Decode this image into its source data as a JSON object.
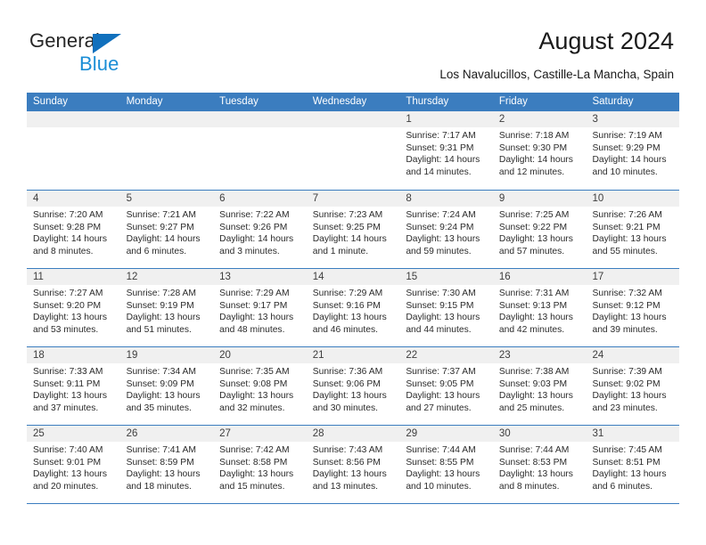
{
  "brand": {
    "name_part1": "General",
    "name_part2": "Blue",
    "accent_dark": "#1170bd",
    "accent_light": "#1b8ed6"
  },
  "header": {
    "title": "August 2024",
    "subtitle": "Los Navalucillos, Castille-La Mancha, Spain"
  },
  "theme": {
    "header_row_bg": "#3b7dbf",
    "daynum_bg": "#f0f0f0",
    "separator": "#3b7dbf"
  },
  "calendar": {
    "weekdays": [
      "Sunday",
      "Monday",
      "Tuesday",
      "Wednesday",
      "Thursday",
      "Friday",
      "Saturday"
    ],
    "weeks": [
      [
        {
          "day": "",
          "empty": true,
          "l1": "",
          "l2": "",
          "l3": "",
          "l4": ""
        },
        {
          "day": "",
          "empty": true,
          "l1": "",
          "l2": "",
          "l3": "",
          "l4": ""
        },
        {
          "day": "",
          "empty": true,
          "l1": "",
          "l2": "",
          "l3": "",
          "l4": ""
        },
        {
          "day": "",
          "empty": true,
          "l1": "",
          "l2": "",
          "l3": "",
          "l4": ""
        },
        {
          "day": "1",
          "l1": "Sunrise: 7:17 AM",
          "l2": "Sunset: 9:31 PM",
          "l3": "Daylight: 14 hours",
          "l4": "and 14 minutes."
        },
        {
          "day": "2",
          "l1": "Sunrise: 7:18 AM",
          "l2": "Sunset: 9:30 PM",
          "l3": "Daylight: 14 hours",
          "l4": "and 12 minutes."
        },
        {
          "day": "3",
          "l1": "Sunrise: 7:19 AM",
          "l2": "Sunset: 9:29 PM",
          "l3": "Daylight: 14 hours",
          "l4": "and 10 minutes."
        }
      ],
      [
        {
          "day": "4",
          "l1": "Sunrise: 7:20 AM",
          "l2": "Sunset: 9:28 PM",
          "l3": "Daylight: 14 hours",
          "l4": "and 8 minutes."
        },
        {
          "day": "5",
          "l1": "Sunrise: 7:21 AM",
          "l2": "Sunset: 9:27 PM",
          "l3": "Daylight: 14 hours",
          "l4": "and 6 minutes."
        },
        {
          "day": "6",
          "l1": "Sunrise: 7:22 AM",
          "l2": "Sunset: 9:26 PM",
          "l3": "Daylight: 14 hours",
          "l4": "and 3 minutes."
        },
        {
          "day": "7",
          "l1": "Sunrise: 7:23 AM",
          "l2": "Sunset: 9:25 PM",
          "l3": "Daylight: 14 hours",
          "l4": "and 1 minute."
        },
        {
          "day": "8",
          "l1": "Sunrise: 7:24 AM",
          "l2": "Sunset: 9:24 PM",
          "l3": "Daylight: 13 hours",
          "l4": "and 59 minutes."
        },
        {
          "day": "9",
          "l1": "Sunrise: 7:25 AM",
          "l2": "Sunset: 9:22 PM",
          "l3": "Daylight: 13 hours",
          "l4": "and 57 minutes."
        },
        {
          "day": "10",
          "l1": "Sunrise: 7:26 AM",
          "l2": "Sunset: 9:21 PM",
          "l3": "Daylight: 13 hours",
          "l4": "and 55 minutes."
        }
      ],
      [
        {
          "day": "11",
          "l1": "Sunrise: 7:27 AM",
          "l2": "Sunset: 9:20 PM",
          "l3": "Daylight: 13 hours",
          "l4": "and 53 minutes."
        },
        {
          "day": "12",
          "l1": "Sunrise: 7:28 AM",
          "l2": "Sunset: 9:19 PM",
          "l3": "Daylight: 13 hours",
          "l4": "and 51 minutes."
        },
        {
          "day": "13",
          "l1": "Sunrise: 7:29 AM",
          "l2": "Sunset: 9:17 PM",
          "l3": "Daylight: 13 hours",
          "l4": "and 48 minutes."
        },
        {
          "day": "14",
          "l1": "Sunrise: 7:29 AM",
          "l2": "Sunset: 9:16 PM",
          "l3": "Daylight: 13 hours",
          "l4": "and 46 minutes."
        },
        {
          "day": "15",
          "l1": "Sunrise: 7:30 AM",
          "l2": "Sunset: 9:15 PM",
          "l3": "Daylight: 13 hours",
          "l4": "and 44 minutes."
        },
        {
          "day": "16",
          "l1": "Sunrise: 7:31 AM",
          "l2": "Sunset: 9:13 PM",
          "l3": "Daylight: 13 hours",
          "l4": "and 42 minutes."
        },
        {
          "day": "17",
          "l1": "Sunrise: 7:32 AM",
          "l2": "Sunset: 9:12 PM",
          "l3": "Daylight: 13 hours",
          "l4": "and 39 minutes."
        }
      ],
      [
        {
          "day": "18",
          "l1": "Sunrise: 7:33 AM",
          "l2": "Sunset: 9:11 PM",
          "l3": "Daylight: 13 hours",
          "l4": "and 37 minutes."
        },
        {
          "day": "19",
          "l1": "Sunrise: 7:34 AM",
          "l2": "Sunset: 9:09 PM",
          "l3": "Daylight: 13 hours",
          "l4": "and 35 minutes."
        },
        {
          "day": "20",
          "l1": "Sunrise: 7:35 AM",
          "l2": "Sunset: 9:08 PM",
          "l3": "Daylight: 13 hours",
          "l4": "and 32 minutes."
        },
        {
          "day": "21",
          "l1": "Sunrise: 7:36 AM",
          "l2": "Sunset: 9:06 PM",
          "l3": "Daylight: 13 hours",
          "l4": "and 30 minutes."
        },
        {
          "day": "22",
          "l1": "Sunrise: 7:37 AM",
          "l2": "Sunset: 9:05 PM",
          "l3": "Daylight: 13 hours",
          "l4": "and 27 minutes."
        },
        {
          "day": "23",
          "l1": "Sunrise: 7:38 AM",
          "l2": "Sunset: 9:03 PM",
          "l3": "Daylight: 13 hours",
          "l4": "and 25 minutes."
        },
        {
          "day": "24",
          "l1": "Sunrise: 7:39 AM",
          "l2": "Sunset: 9:02 PM",
          "l3": "Daylight: 13 hours",
          "l4": "and 23 minutes."
        }
      ],
      [
        {
          "day": "25",
          "l1": "Sunrise: 7:40 AM",
          "l2": "Sunset: 9:01 PM",
          "l3": "Daylight: 13 hours",
          "l4": "and 20 minutes."
        },
        {
          "day": "26",
          "l1": "Sunrise: 7:41 AM",
          "l2": "Sunset: 8:59 PM",
          "l3": "Daylight: 13 hours",
          "l4": "and 18 minutes."
        },
        {
          "day": "27",
          "l1": "Sunrise: 7:42 AM",
          "l2": "Sunset: 8:58 PM",
          "l3": "Daylight: 13 hours",
          "l4": "and 15 minutes."
        },
        {
          "day": "28",
          "l1": "Sunrise: 7:43 AM",
          "l2": "Sunset: 8:56 PM",
          "l3": "Daylight: 13 hours",
          "l4": "and 13 minutes."
        },
        {
          "day": "29",
          "l1": "Sunrise: 7:44 AM",
          "l2": "Sunset: 8:55 PM",
          "l3": "Daylight: 13 hours",
          "l4": "and 10 minutes."
        },
        {
          "day": "30",
          "l1": "Sunrise: 7:44 AM",
          "l2": "Sunset: 8:53 PM",
          "l3": "Daylight: 13 hours",
          "l4": "and 8 minutes."
        },
        {
          "day": "31",
          "l1": "Sunrise: 7:45 AM",
          "l2": "Sunset: 8:51 PM",
          "l3": "Daylight: 13 hours",
          "l4": "and 6 minutes."
        }
      ]
    ]
  }
}
